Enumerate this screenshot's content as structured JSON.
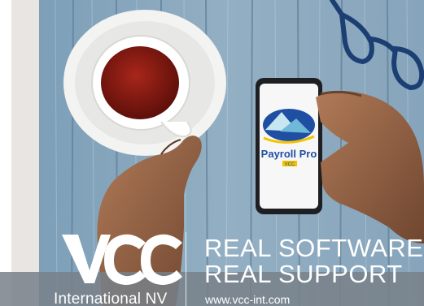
{
  "colors": {
    "wood_blue": "#7fa3bd",
    "wood_grey": "#9fb3c2",
    "tea": "#8c1a12",
    "banner": "#7a828a",
    "logo_blue": "#1f4fa3"
  },
  "phone_app": {
    "name": "Payroll Pro",
    "badge": "VCC"
  },
  "brand": {
    "logo_text": "VCC",
    "company": "International NV",
    "tagline_line1": "REAL SOFTWARE",
    "tagline_line2": "REAL SUPPORT",
    "url": "www.vcc-int.com"
  }
}
